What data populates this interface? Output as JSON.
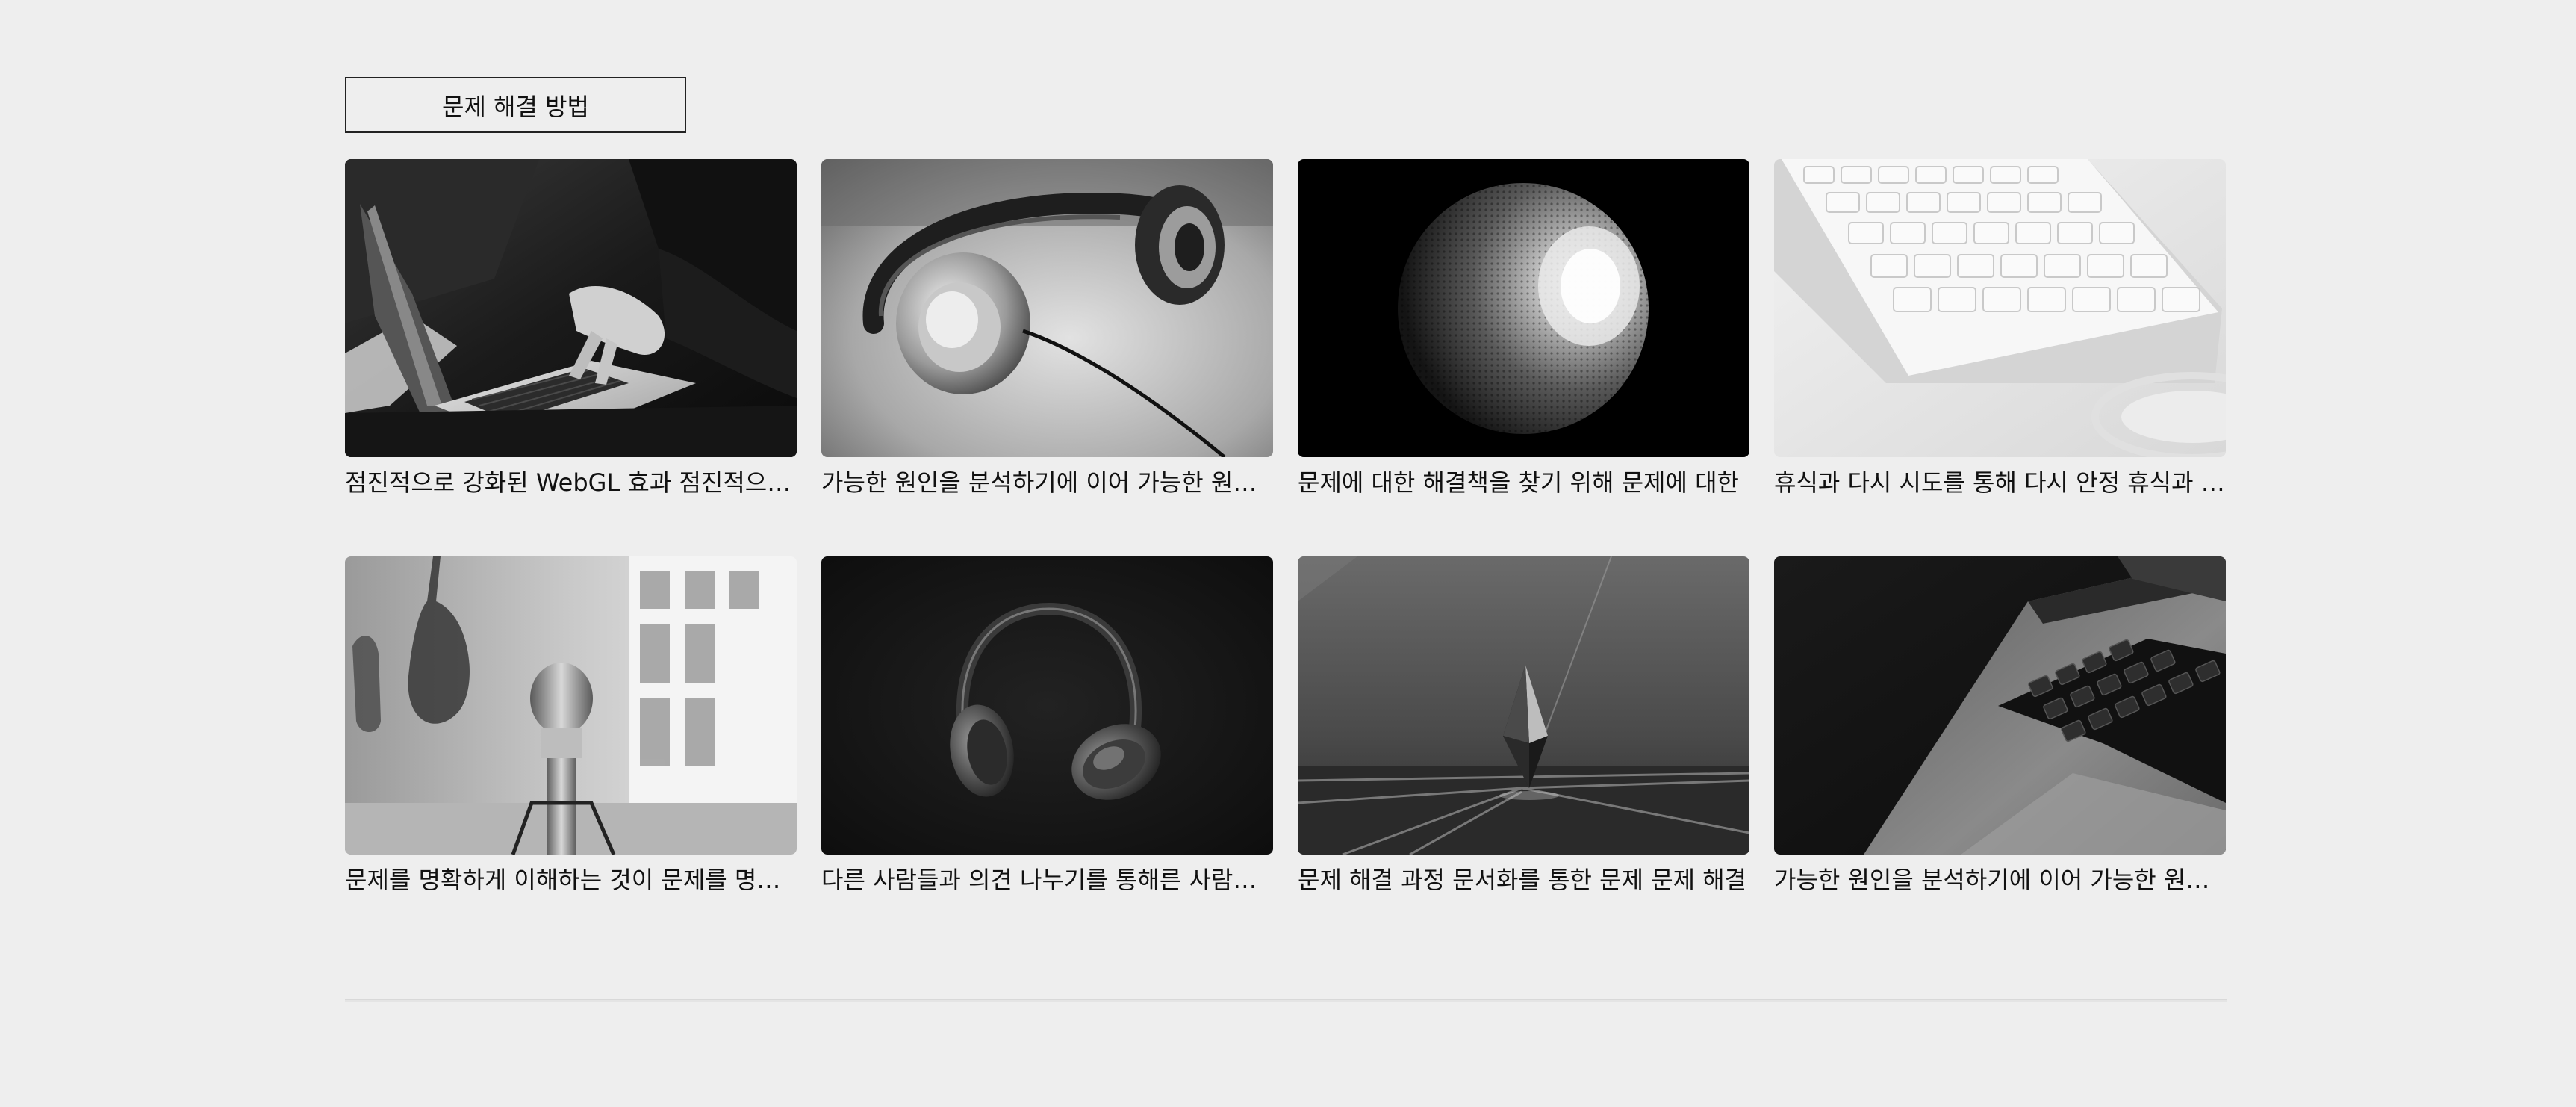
{
  "category": {
    "label": "문제 해결 방법"
  },
  "cards": [
    {
      "title": "점진적으로 강화된 WebGL 효과 점진적으로 강화된",
      "image": "laptop-typing-photo"
    },
    {
      "title": "가능한 원인을 분석하기에 이어 가능한 원인을",
      "image": "headphones-on-table-photo"
    },
    {
      "title": "문제에 대한 해결책을 찾기 위해 문제에 대한",
      "image": "smart-speaker-photo"
    },
    {
      "title": "휴식과 다시 시도를 통해 다시 안정 휴식과 다시",
      "image": "keyboard-photo"
    },
    {
      "title": "문제를 명확하게 이해하는 것이 문제를 명확하게",
      "image": "microphone-studio-photo"
    },
    {
      "title": "다른 사람들과 의견 나누기를 통해른 사람들과",
      "image": "headphones-dark-photo"
    },
    {
      "title": "문제 해결 과정 문서화를 통한 문제 문제 해결",
      "image": "crystal-prism-photo"
    },
    {
      "title": "가능한 원인을 분석하기에 이어 가능한 원인을",
      "image": "laptop-closeup-photo"
    }
  ]
}
